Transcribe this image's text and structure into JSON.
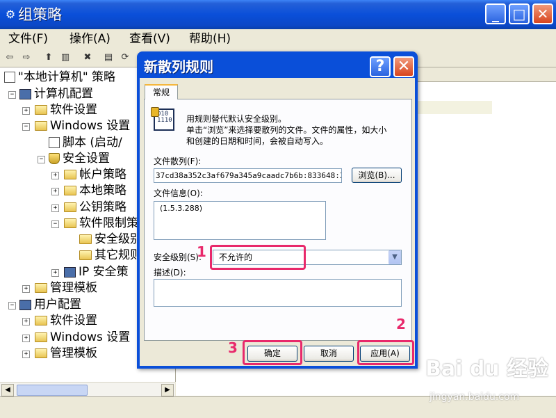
{
  "window": {
    "title": "组策略",
    "icon": "policy-icon",
    "controls": {
      "minimize": "_",
      "maximize": "□",
      "close": "✕"
    }
  },
  "menu": [
    {
      "label": "文件(F)"
    },
    {
      "label": "操作(A)"
    },
    {
      "label": "查看(V)"
    },
    {
      "label": "帮助(H)"
    }
  ],
  "toolbar": {
    "back": "⇦",
    "forward": "⇨",
    "up": "⬆",
    "show_tree": "▥",
    "delete": "✖",
    "properties": "▤",
    "refresh": "⟳",
    "export": "⎘",
    "help": "?"
  },
  "tree": {
    "root": "\"本地计算机\" 策略",
    "computer_config": "计算机配置",
    "software_settings": "软件设置",
    "windows_settings": "Windows 设置",
    "scripts": "脚本 (启动/",
    "security_settings": "安全设置",
    "account_policies": "帐户策略",
    "local_policies": "本地策略",
    "public_key_policies": "公钥策略",
    "software_restriction": "软件限制策",
    "security_levels": "安全级别",
    "other_rules": "其它规则",
    "ip_security": "IP 安全策",
    "admin_templates": "管理模板",
    "user_config": "用户配置",
    "user_software_settings": "软件设置",
    "user_windows_settings": "Windows 设置",
    "user_admin_templates": "管理模板"
  },
  "dialog": {
    "title": "新散列规则",
    "help": "?",
    "close": "✕",
    "tab": "常规",
    "description_line1": "用规则替代默认安全级别。",
    "description_line2": "单击“浏览”来选择要散列的文件。文件的属性，如大小",
    "description_line3": "和创建的日期和时间，会被自动写入。",
    "cert_icon_text": "010 1110",
    "file_hash_label": "文件散列(F):",
    "file_hash_value": "37cd38a352c3af679a345a9caadc7b6b:833648:32771",
    "browse_button": "浏览(B)...",
    "file_info_label": "文件信息(O):",
    "file_info_value": "(1.5.3.288)",
    "security_level_label": "安全级别(S):",
    "security_level_value": "不允许的",
    "description_label": "描述(D):",
    "description_value": "",
    "ok_button": "确定",
    "cancel_button": "取消",
    "apply_button": "应用(A)"
  },
  "annotations": {
    "marker1": "1",
    "marker2": "2",
    "marker3": "3"
  },
  "watermark": {
    "logo": "Bai du 经验",
    "url": "jingyan.baidu.com"
  },
  "colors": {
    "titlebar": "#0a4fd9",
    "highlight": "#e8296b",
    "dialog_body": "#ece9d8"
  }
}
